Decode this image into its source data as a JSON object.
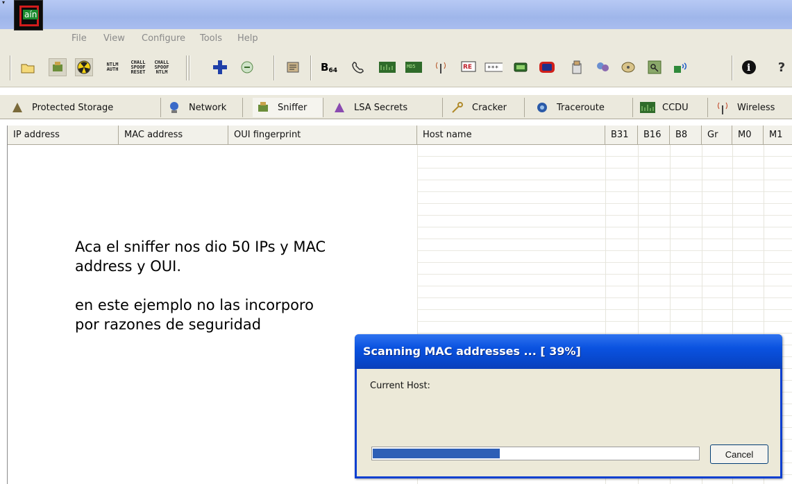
{
  "app": {
    "logo_text": "aín"
  },
  "menu": [
    "File",
    "View",
    "Configure",
    "Tools",
    "Help"
  ],
  "toolbar": {
    "ntlm_auth": [
      "NTLM",
      "AUTH"
    ],
    "chall_spoof_reset": [
      "CHALL",
      "SPOOF",
      "RESET"
    ],
    "chall_spoof_ntlm": [
      "CHALL",
      "SPOOF",
      "NTLM"
    ],
    "b64_label": "B",
    "b64_sub": "64"
  },
  "tabs": [
    {
      "label": "Protected Storage"
    },
    {
      "label": "Network"
    },
    {
      "label": "Sniffer",
      "active": true
    },
    {
      "label": "LSA Secrets"
    },
    {
      "label": "Cracker"
    },
    {
      "label": "Traceroute"
    },
    {
      "label": "CCDU"
    },
    {
      "label": "Wireless"
    }
  ],
  "grid": {
    "columns": [
      "IP address",
      "MAC address",
      "OUI fingerprint",
      "Host name",
      "B31",
      "B16",
      "B8",
      "Gr",
      "M0",
      "M1"
    ],
    "rows": []
  },
  "annotation": {
    "para1": "Aca el sniffer nos dio 50 IPs y MAC address y OUI.",
    "para2": "en este ejemplo no las incorporo por razones de seguridad"
  },
  "dialog": {
    "title": "Scanning MAC addresses ... [ 39%]",
    "host_label": "Current Host:",
    "progress": 0.39,
    "cancel_label": "Cancel"
  },
  "colors": {
    "titlebar": "#a9bdef",
    "dialog_title": "#0a52e0",
    "progress": "#2e5fb6",
    "logo_frame": "#d21c1c"
  }
}
